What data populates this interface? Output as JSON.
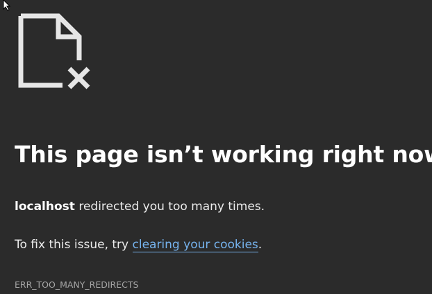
{
  "error_page": {
    "icon": "broken-document-icon",
    "title": "This page isn’t working right now",
    "host": "localhost",
    "message_rest": " redirected you too many times.",
    "fix_prefix": "To fix this issue, try ",
    "fix_link": "clearing your cookies",
    "fix_suffix": ".",
    "error_code": "ERR_TOO_MANY_REDIRECTS"
  },
  "colors": {
    "background": "#2b2b2b",
    "text": "#ffffff",
    "link": "#76b3ee",
    "code": "#a6a6a6"
  }
}
